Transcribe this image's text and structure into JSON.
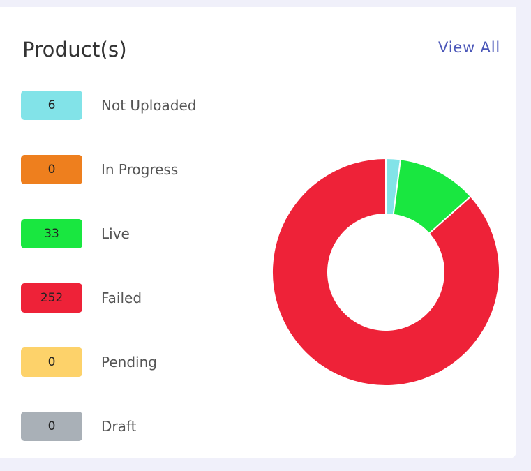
{
  "header": {
    "title": "Product(s)",
    "view_all_label": "View All"
  },
  "chart_data": {
    "type": "pie",
    "title": "",
    "donut": true,
    "categories": [
      "Not Uploaded",
      "In Progress",
      "Live",
      "Failed",
      "Pending",
      "Draft"
    ],
    "values": [
      6,
      0,
      33,
      252,
      0,
      0
    ],
    "colors": [
      "#82e3e8",
      "#ee7f1e",
      "#19e740",
      "#ee2238",
      "#fdd26a",
      "#a9b0b7"
    ],
    "start_angle_deg": 0,
    "direction": "clockwise",
    "legend": "left"
  }
}
